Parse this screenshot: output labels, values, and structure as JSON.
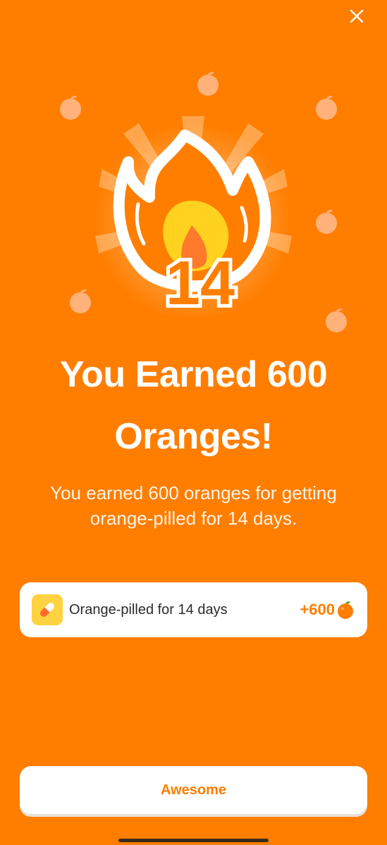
{
  "close": {
    "icon": "close-icon"
  },
  "hero": {
    "streak_number": "14",
    "icon": "flame-icon",
    "decor_icon": "orange-fruit-icon"
  },
  "title": {
    "line1": "You Earned 600",
    "line2": "Oranges!"
  },
  "subtitle": "You earned 600 oranges for getting orange-pilled for 14 days.",
  "reward": {
    "icon": "pill-icon",
    "label": "Orange-pilled for 14 days",
    "amount": "+600",
    "amount_icon": "orange-emoji-icon"
  },
  "cta": {
    "label": "Awesome"
  },
  "colors": {
    "background": "#FF7E00",
    "accent": "#FF7E00",
    "card": "#FFFFFF",
    "pill_tile": "#FFD23F"
  }
}
